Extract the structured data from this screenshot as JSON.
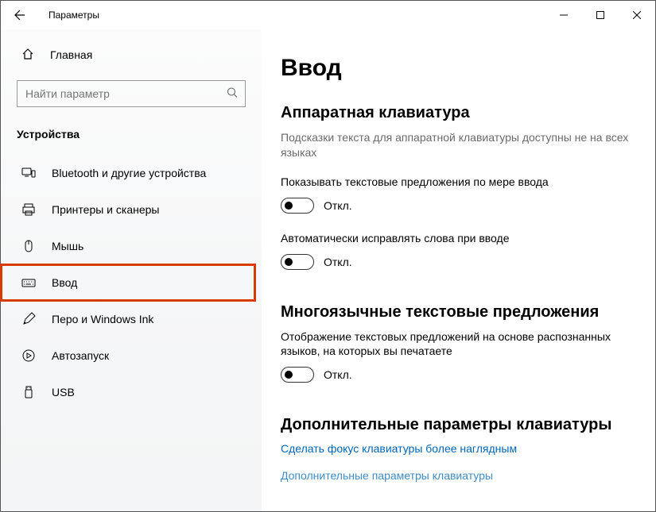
{
  "window": {
    "title": "Параметры"
  },
  "sidebar": {
    "home_label": "Главная",
    "search_placeholder": "Найти параметр",
    "category": "Устройства",
    "items": [
      {
        "label": "Bluetooth и другие устройства"
      },
      {
        "label": "Принтеры и сканеры"
      },
      {
        "label": "Мышь"
      },
      {
        "label": "Ввод"
      },
      {
        "label": "Перо и Windows Ink"
      },
      {
        "label": "Автозапуск"
      },
      {
        "label": "USB"
      }
    ]
  },
  "main": {
    "title": "Ввод",
    "hw_keyboard": {
      "heading": "Аппаратная клавиатура",
      "desc": "Подсказки текста для аппаратной клавиатуры доступны не на всех языках",
      "opt1_label": "Показывать текстовые предложения по мере ввода",
      "opt1_state": "Откл.",
      "opt2_label": "Автоматически исправлять слова при вводе",
      "opt2_state": "Откл."
    },
    "multilang": {
      "heading": "Многоязычные текстовые предложения",
      "desc": "Отображение текстовых предложений на основе распознанных языков, на которых вы печатаете",
      "state": "Откл."
    },
    "advanced": {
      "heading": "Дополнительные параметры клавиатуры",
      "link1": "Сделать фокус клавиатуры более наглядным",
      "link2": "Дополнительные параметры клавиатуры"
    }
  }
}
